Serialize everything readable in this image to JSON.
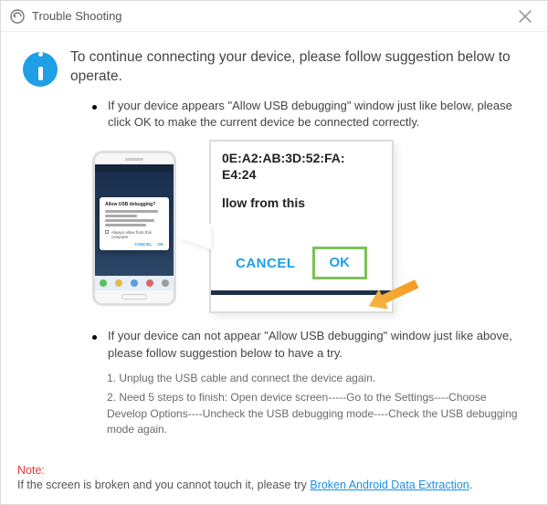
{
  "titlebar": {
    "title": "Trouble Shooting"
  },
  "heading": "To continue connecting your device, please follow suggestion below to operate.",
  "bullets": {
    "b1": "If your device appears \"Allow USB debugging\" window just like below, please click OK to make the current device  be connected correctly.",
    "b2": "If your device can not appear \"Allow USB debugging\" window just like above, please follow suggestion below to have a try."
  },
  "phone_dialog": {
    "title": "Allow USB debugging?",
    "check_label": "Always allow from this computer",
    "cancel": "CANCEL",
    "ok": "OK"
  },
  "zoom": {
    "mac_line1": "0E:A2:AB:3D:52:FA:",
    "mac_line2": "E4:24",
    "allow_line": "llow from this",
    "cancel": "CANCEL",
    "ok": "OK"
  },
  "steps": {
    "s1": "1. Unplug the USB cable and connect the device again.",
    "s2": "2. Need 5 steps to finish: Open device screen-----Go to the Settings----Choose Develop Options----Uncheck the USB debugging mode----Check the USB debugging mode again."
  },
  "note": {
    "title": "Note:",
    "text_before": "If the screen is broken and you cannot touch it, please try ",
    "link": "Broken Android Data Extraction",
    "text_after": "."
  }
}
